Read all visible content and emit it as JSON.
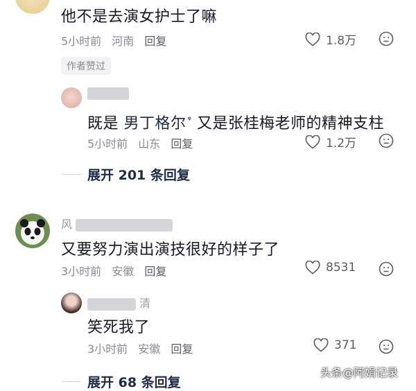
{
  "comment_top": {
    "text": "他不是去演女护士了嘛",
    "time": "5小时前",
    "location": "河南",
    "reply_label": "回复",
    "likes": "1.8万",
    "badge": "作者赞过"
  },
  "reply_1": {
    "text_prefix": "既是",
    "link_text": "男丁格尔",
    "text_suffix": "又是张桂梅老师的精神支柱",
    "time": "5小时前",
    "location": "山东",
    "reply_label": "回复",
    "likes": "1.2万"
  },
  "expand_1": {
    "label": "展开 201 条回复"
  },
  "comment_2": {
    "username": "风",
    "text": "又要努力演出演技很好的样子了",
    "time": "3小时前",
    "location": "安徽",
    "reply_label": "回复",
    "likes": "8531"
  },
  "reply_2": {
    "username": "清",
    "text": "笑死我了",
    "time": "3小时前",
    "location": "安徽",
    "reply_label": "回复",
    "likes": "371"
  },
  "expand_2": {
    "label": "展开 68 条回复"
  },
  "watermark": {
    "text": "头条@阿娟记录"
  },
  "colors": {
    "accent": "#1f2a44",
    "meta": "#8a8b91",
    "text": "#161823"
  }
}
